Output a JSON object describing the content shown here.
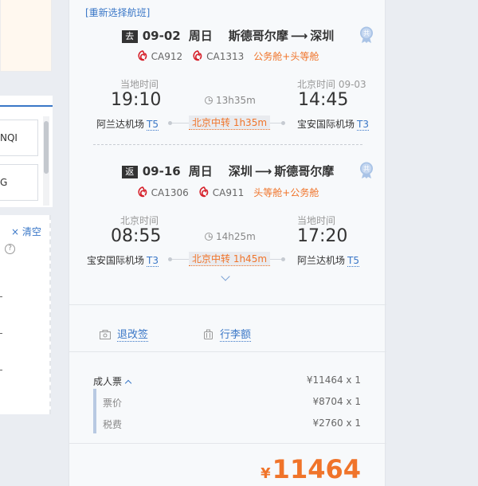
{
  "left": {
    "tab1_text": "NQI",
    "tab2_text": "G",
    "clear_label": "× 清空",
    "help_glyph": "?"
  },
  "card": {
    "reselect_label": "[重新选择航班]",
    "segments": [
      {
        "dir_badge": "去",
        "date": "09-02",
        "weekday": "周日",
        "from_city": "斯德哥尔摩",
        "to_city": "深圳",
        "flights": [
          "CA912",
          "CA1313"
        ],
        "cabin": "公务舱+头等舱",
        "dep_label": "当地时间",
        "dep_time": "19:10",
        "dep_airport": "阿兰达机场",
        "dep_terminal": "T5",
        "arr_label": "北京时间  09-03",
        "arr_time": "14:45",
        "arr_airport": "宝安国际机场",
        "arr_terminal": "T3",
        "duration": "13h35m",
        "transfer": "北京中转 1h35m"
      },
      {
        "dir_badge": "返",
        "date": "09-16",
        "weekday": "周日",
        "from_city": "深圳",
        "to_city": "斯德哥尔摩",
        "flights": [
          "CA1306",
          "CA911"
        ],
        "cabin": "头等舱+公务舱",
        "dep_label": "北京时间",
        "dep_time": "08:55",
        "dep_airport": "宝安国际机场",
        "dep_terminal": "T3",
        "arr_label": "当地时间",
        "arr_time": "17:20",
        "arr_airport": "阿兰达机场",
        "arr_terminal": "T5",
        "duration": "14h25m",
        "transfer": "北京中转 1h45m"
      }
    ],
    "policy": {
      "refund_label": "退改签",
      "baggage_label": "行李额"
    },
    "fare": {
      "adult_label": "成人票",
      "adult_value": "¥11464 x 1",
      "base_label": "票价",
      "base_value": "¥8704 x 1",
      "tax_label": "税费",
      "tax_value": "¥2760 x 1"
    },
    "total": {
      "currency": "¥",
      "amount": "11464"
    }
  },
  "colors": {
    "accent_blue": "#3a77c7",
    "orange": "#f0742a",
    "airline_red": "#d6202a"
  },
  "icons": {
    "medal": "shared-flight-badge-icon",
    "airline": "air-china-logo-icon",
    "clock": "clock-icon",
    "refund": "refund-ticket-icon",
    "baggage": "luggage-icon"
  }
}
